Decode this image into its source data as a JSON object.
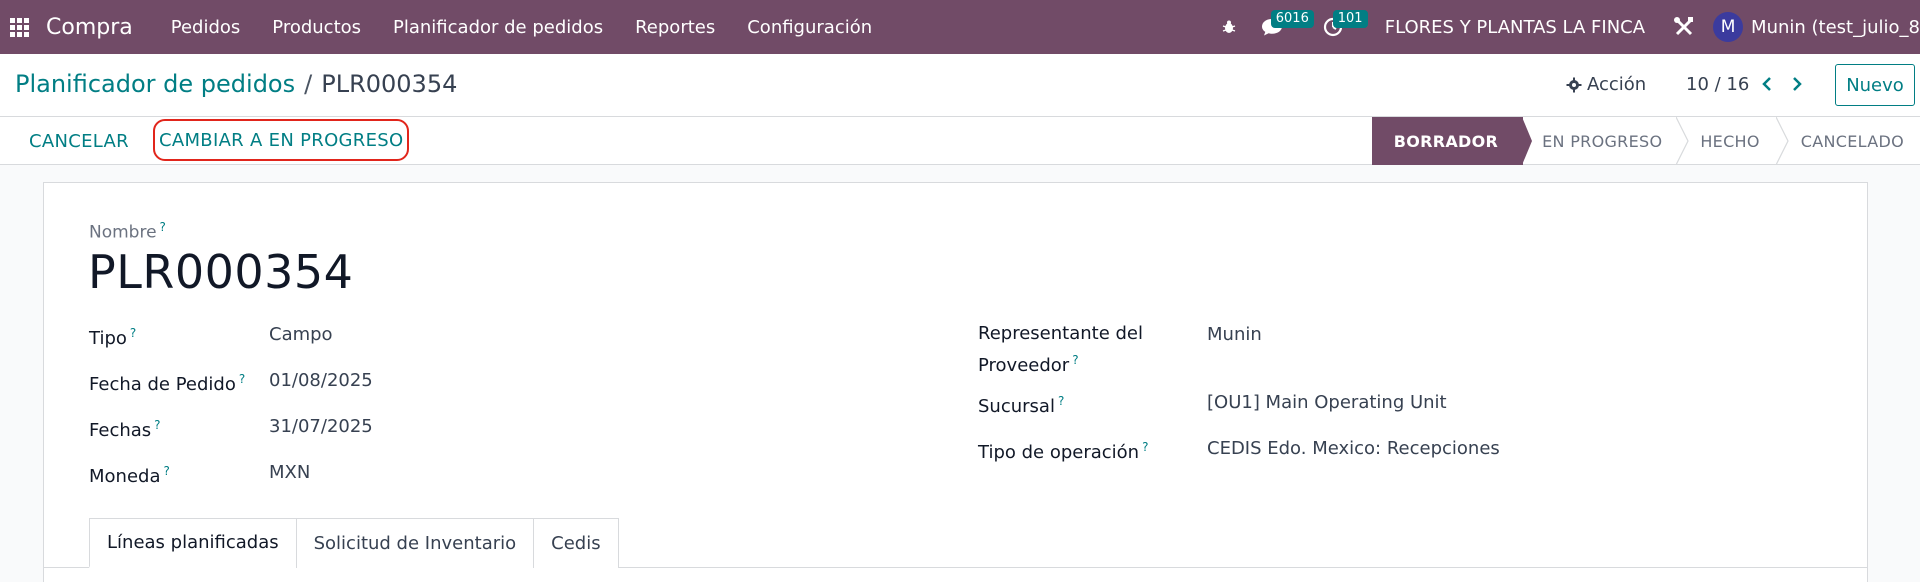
{
  "navbar": {
    "brand": "Compra",
    "menu": [
      "Pedidos",
      "Productos",
      "Planificador de pedidos",
      "Reportes",
      "Configuración"
    ],
    "messages_count": "6016",
    "activities_count": "101",
    "company": "FLORES Y PLANTAS LA FINCA",
    "user_initial": "M",
    "user_name": "Munin (test_julio_8"
  },
  "control": {
    "breadcrumb_parent": "Planificador de pedidos",
    "breadcrumb_sep": "/",
    "breadcrumb_current": "PLR000354",
    "action_label": "Acción",
    "pager": "10 / 16",
    "new_label": "Nuevo"
  },
  "statusbar": {
    "cancel_label": "CANCELAR",
    "progress_label": "CAMBIAR A EN PROGRESO",
    "stages": [
      {
        "label": "BORRADOR",
        "active": true
      },
      {
        "label": "EN PROGRESO",
        "active": false
      },
      {
        "label": "HECHO",
        "active": false
      },
      {
        "label": "CANCELADO",
        "active": false
      }
    ]
  },
  "form": {
    "name_label": "Nombre",
    "name_value": "PLR000354",
    "left_fields": [
      {
        "label": "Tipo",
        "value": "Campo"
      },
      {
        "label": "Fecha de Pedido",
        "value": "01/08/2025"
      },
      {
        "label": "Fechas",
        "value": "31/07/2025"
      },
      {
        "label": "Moneda",
        "value": "MXN"
      }
    ],
    "right_fields": [
      {
        "label_line1": "Representante del",
        "label_line2": "Proveedor",
        "value": "Munin"
      },
      {
        "label": "Sucursal",
        "value": "[OU1] Main Operating Unit"
      },
      {
        "label": "Tipo de operación",
        "value": "CEDIS Edo. Mexico: Recepciones"
      }
    ],
    "help_mark": "?",
    "tabs": [
      "Líneas planificadas",
      "Solicitud de Inventario",
      "Cedis"
    ]
  },
  "colors": {
    "brand": "#714b67",
    "link": "#017e84",
    "highlight_border": "#e1251b"
  }
}
